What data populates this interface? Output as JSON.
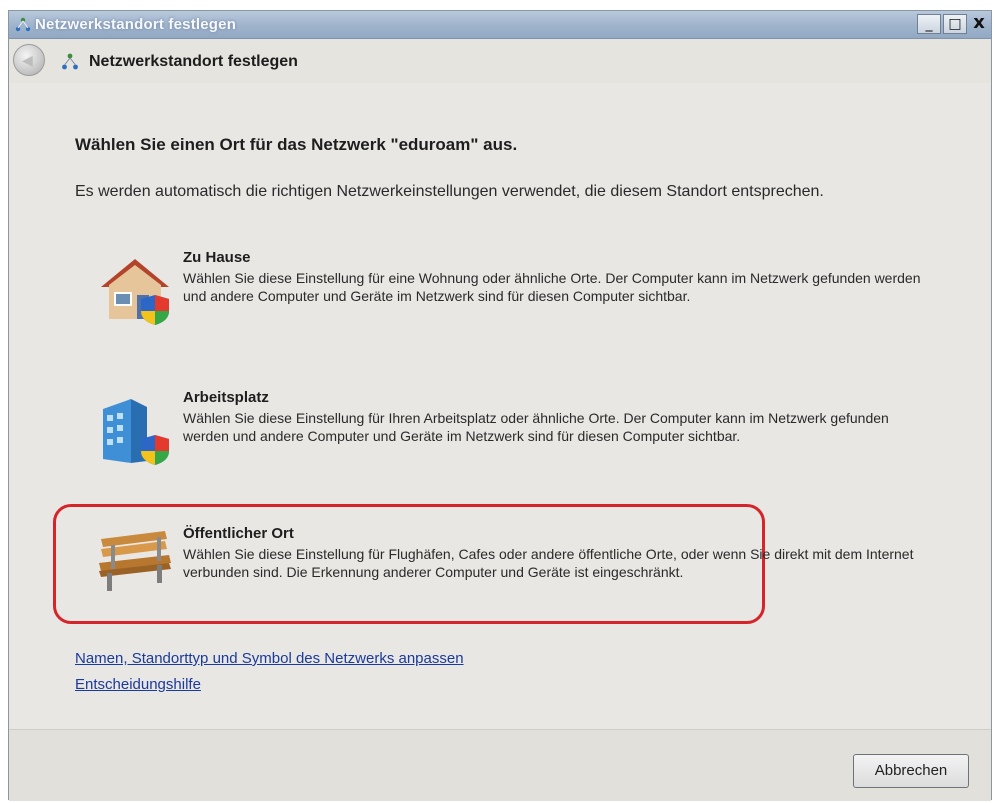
{
  "window": {
    "title": "Netzwerkstandort festlegen",
    "buttons": {
      "minimize": "_",
      "maximize": "□",
      "close": "x"
    }
  },
  "nav": {
    "title": "Netzwerkstandort festlegen"
  },
  "main": {
    "heading": "Wählen Sie einen Ort für das Netzwerk \"eduroam\" aus.",
    "description": "Es werden automatisch die richtigen Netzwerkeinstellungen verwendet, die diesem Standort entsprechen.",
    "options": [
      {
        "icon": "home-icon",
        "title": "Zu Hause",
        "text": "Wählen Sie diese Einstellung für eine Wohnung oder ähnliche Orte. Der Computer kann im Netzwerk gefunden werden und andere Computer und Geräte im Netzwerk sind für diesen Computer sichtbar."
      },
      {
        "icon": "office-building-icon",
        "title": "Arbeitsplatz",
        "text": "Wählen Sie diese Einstellung für Ihren Arbeitsplatz oder ähnliche Orte. Der Computer kann im Netzwerk gefunden werden und andere Computer und Geräte im Netzwerk sind für diesen Computer sichtbar."
      },
      {
        "icon": "park-bench-icon",
        "title": "Öffentlicher Ort",
        "text": "Wählen Sie diese Einstellung für Flughäfen, Cafes oder andere öffentliche Orte, oder wenn Sie direkt mit dem Internet verbunden sind. Die Erkennung anderer Computer und Geräte ist eingeschränkt."
      }
    ],
    "links": [
      "Namen, Standorttyp und Symbol des Netzwerks anpassen",
      "Entscheidungshilfe"
    ]
  },
  "footer": {
    "cancel_label": "Abbrechen"
  },
  "colors": {
    "highlight": "#d5252b",
    "link": "#1a3a9c"
  }
}
